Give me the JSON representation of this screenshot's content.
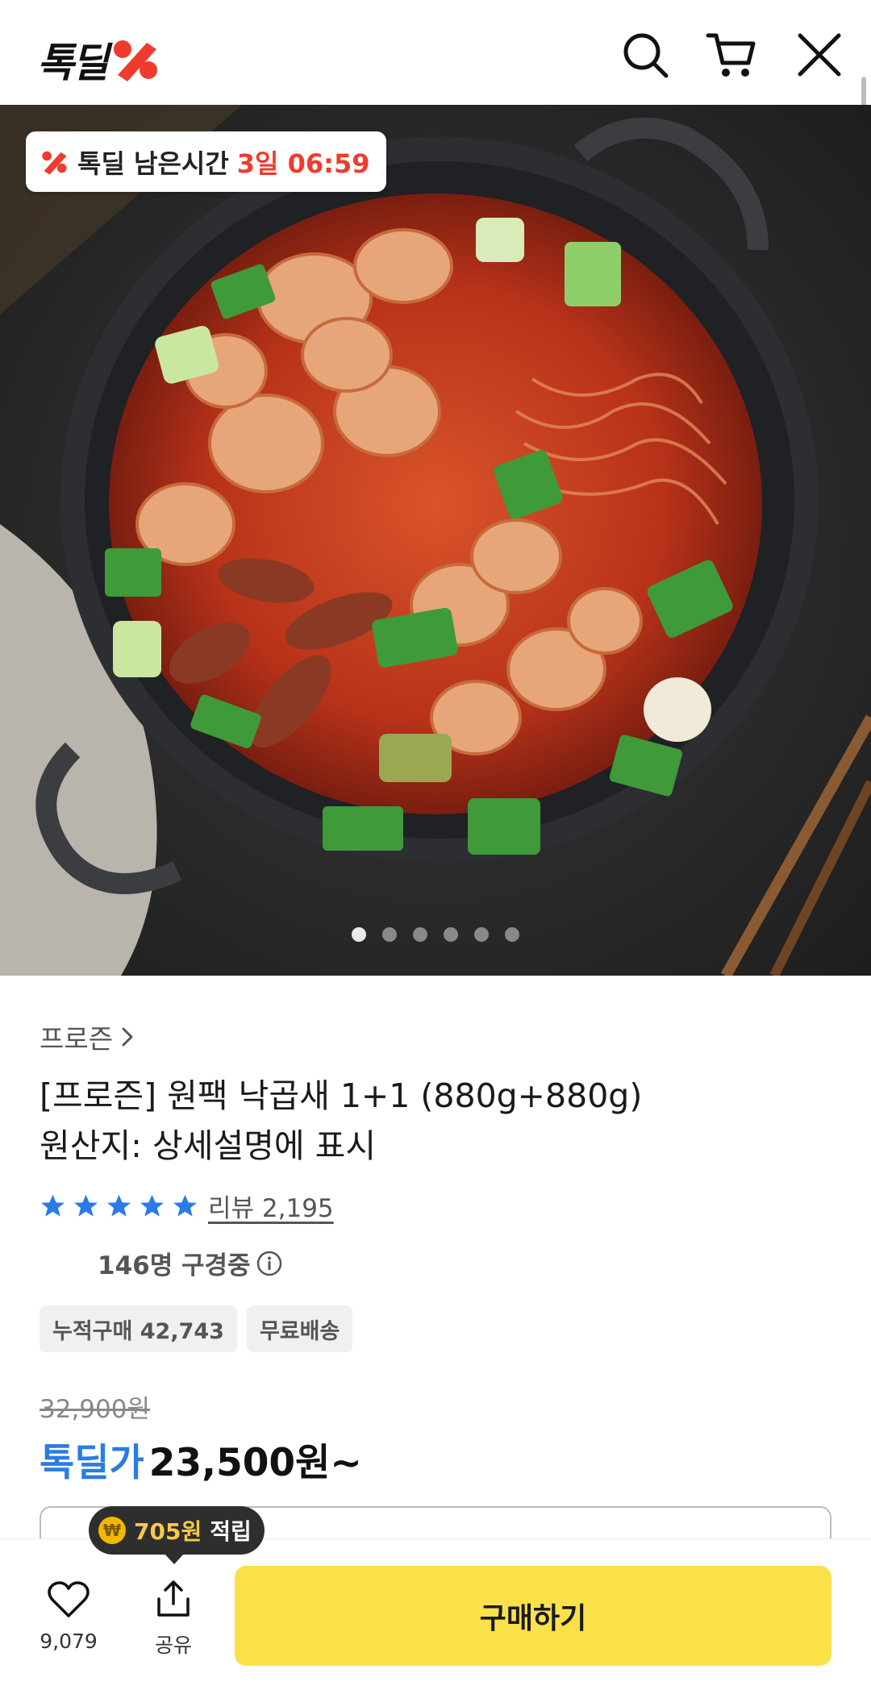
{
  "header": {
    "logo_text": "톡딜",
    "search_icon": "search-icon",
    "cart_icon": "cart-icon",
    "close_icon": "close-icon"
  },
  "hero": {
    "timer_label": "톡딜 남은시간",
    "timer_value": "3일 06:59",
    "image_count": 6,
    "active_index": 0
  },
  "product": {
    "category": "프로즌",
    "title_line1": "[프로즌] 원팩 낙곱새 1+1 (880g+880g)",
    "title_line2": "원산지: 상세설명에 표시",
    "rating_stars": 5,
    "review_link": "리뷰 2,195",
    "viewers": "146명 구경중",
    "tags": [
      "누적구매 42,743",
      "무료배송"
    ],
    "original_price": "32,900원",
    "deal_label": "톡딜가",
    "deal_price": "23,500원~"
  },
  "points_tip": {
    "value": "705원",
    "label": "적립"
  },
  "bottom_bar": {
    "like_count": "9,079",
    "share_label": "공유",
    "buy_label": "구매하기"
  },
  "colors": {
    "brand_red": "#ef3b2d",
    "deal_blue": "#2a7be4",
    "buy_yellow": "#fae14a",
    "star_blue": "#2a7be4"
  }
}
